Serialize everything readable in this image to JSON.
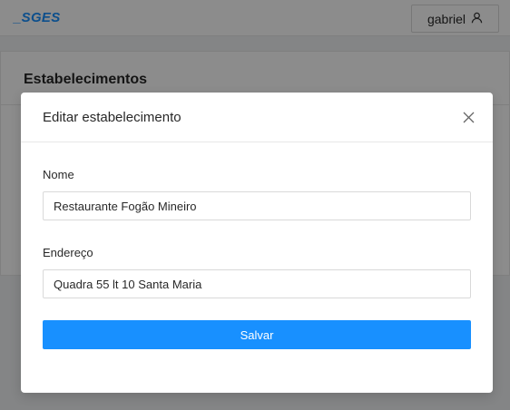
{
  "app": {
    "logo": "_SGES",
    "user": {
      "name": "gabriel",
      "icon": "user-icon"
    }
  },
  "page": {
    "title": "Estabelecimentos"
  },
  "modal": {
    "title": "Editar estabelecimento",
    "close_icon": "close-icon",
    "fields": {
      "nome": {
        "label": "Nome",
        "value": "Restaurante Fogão Mineiro"
      },
      "endereco": {
        "label": "Endereço",
        "value": "Quadra 55 lt 10 Santa Maria"
      }
    },
    "submit_label": "Salvar"
  },
  "colors": {
    "primary": "#1890ff",
    "mask": "rgba(0,0,0,0.45)"
  }
}
